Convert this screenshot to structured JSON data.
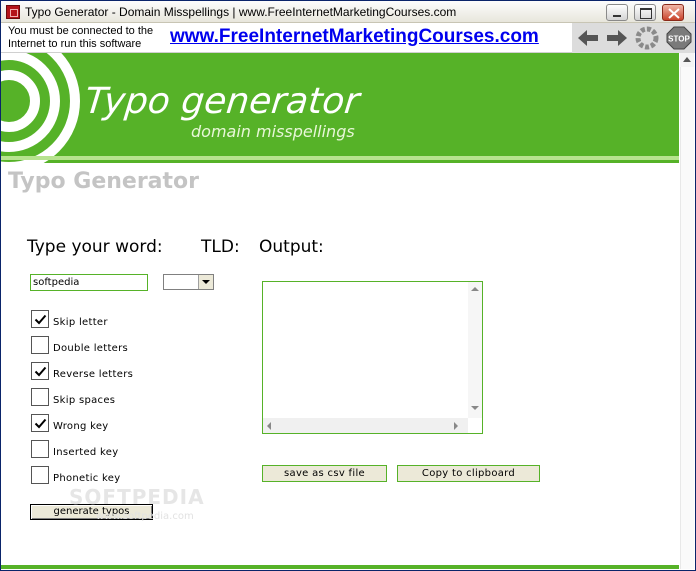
{
  "window": {
    "title": "Typo Generator - Domain Misspellings | www.FreeInternetMarketingCourses.com"
  },
  "infobar": {
    "notice": "You must be connected to the Internet to run this software",
    "link_text": "www.FreeInternetMarketingCourses.com"
  },
  "navigation": {
    "stop_label": "STOP"
  },
  "banner": {
    "title": "Typo generator",
    "subtitle": "domain misspellings"
  },
  "page": {
    "heading": "Typo Generator"
  },
  "form": {
    "word_label": "Type your word:",
    "tld_label": "TLD:",
    "output_label": "Output:",
    "word_value": "softpedia",
    "tld_value": "",
    "options": [
      {
        "label": "Skip letter",
        "checked": true
      },
      {
        "label": "Double letters",
        "checked": false
      },
      {
        "label": "Reverse letters",
        "checked": true
      },
      {
        "label": "Skip spaces",
        "checked": false
      },
      {
        "label": "Wrong key",
        "checked": true
      },
      {
        "label": "Inserted key",
        "checked": false
      },
      {
        "label": "Phonetic key",
        "checked": false
      }
    ],
    "generate_label": "generate typos",
    "output_value": "",
    "save_csv_label": "save as csv file",
    "copy_label": "Copy to clipboard"
  },
  "watermark": {
    "text": "SOFTPEDIA",
    "url": "www.softpedia.com"
  },
  "colors": {
    "brand_green": "#56b228",
    "light_green": "#b7e38f",
    "link_blue": "#0000ee",
    "heading_gray": "#c4c4c4"
  }
}
